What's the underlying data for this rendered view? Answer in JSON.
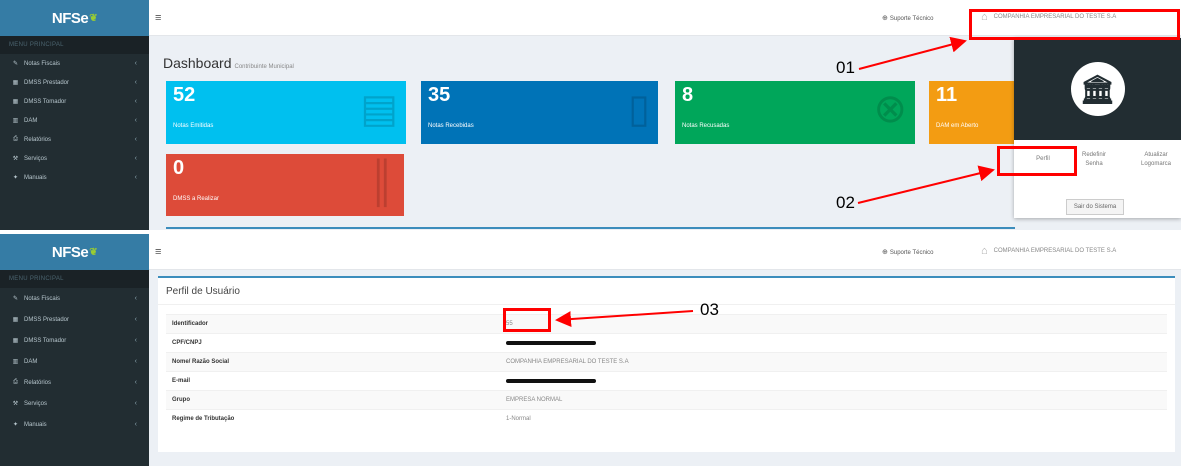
{
  "app": {
    "logo_text": "NFSe",
    "menu_header": "MENU PRINCIPAL",
    "support_label": "Suporte Técnico",
    "company_name": "COMPANHIA EMPRESARIAL DO TESTE S.A"
  },
  "sidebar": {
    "items": [
      {
        "label": "Notas Fiscais",
        "icon": "notes-icon"
      },
      {
        "label": "DMSS Prestador",
        "icon": "grid-icon"
      },
      {
        "label": "DMSS Tomador",
        "icon": "grid-icon"
      },
      {
        "label": "DAM",
        "icon": "barcode-icon"
      },
      {
        "label": "Relatórios",
        "icon": "print-icon"
      },
      {
        "label": "Serviços",
        "icon": "tools-icon"
      },
      {
        "label": "Manuais",
        "icon": "book-icon"
      }
    ]
  },
  "dashboard": {
    "title": "Dashboard",
    "subtitle": "Contribuinte Municipal",
    "tiles": [
      {
        "count": "52",
        "label": "Notas Emitidas",
        "color": "#00c0ef"
      },
      {
        "count": "35",
        "label": "Notas Recebidas",
        "color": "#0073b7"
      },
      {
        "count": "8",
        "label": "Notas Recusadas",
        "color": "#00a65a"
      },
      {
        "count": "11",
        "label": "DAM em Aberto",
        "color": "#f39c12"
      },
      {
        "count": "0",
        "label": "DMSS a Realizar",
        "color": "#dd4b39"
      }
    ]
  },
  "user_menu": {
    "links": [
      "Perfil",
      "Redefinir Senha",
      "Atualizar Logomarca"
    ],
    "logout": "Sair do Sistema"
  },
  "annotations": [
    "01",
    "02",
    "03"
  ],
  "profile": {
    "title": "Perfil de Usuário",
    "rows": [
      {
        "key": "Identificador",
        "value": "55",
        "redacted": false
      },
      {
        "key": "CPF/CNPJ",
        "value": "",
        "redacted": true
      },
      {
        "key": "Nome/ Razão Social",
        "value": "COMPANHIA EMPRESARIAL DO TESTE S.A",
        "redacted": false
      },
      {
        "key": "E-mail",
        "value": "",
        "redacted": true
      },
      {
        "key": "Grupo",
        "value": "EMPRESA NORMAL",
        "redacted": false
      },
      {
        "key": "Regime de Tributação",
        "value": "1-Normal",
        "redacted": false
      }
    ]
  },
  "colors": {
    "sidebar_bg": "#222d32",
    "logo_bg": "#357ca5",
    "highlight": "#ff0000",
    "accent": "#3c8dbc"
  }
}
